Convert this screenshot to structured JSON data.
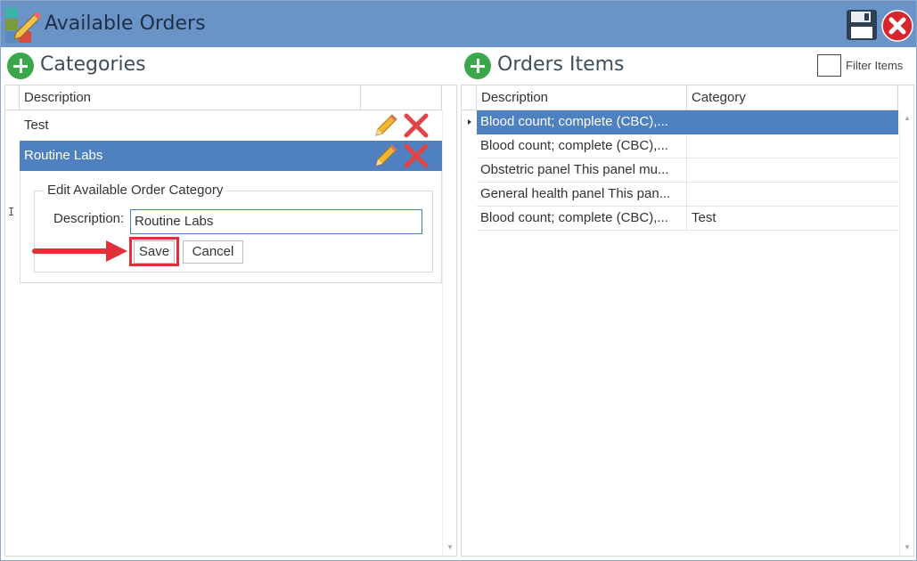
{
  "window": {
    "title": "Available Orders",
    "icons": {
      "app": "app-pencil-icon",
      "save": "floppy-disk-icon",
      "close": "close-circle-icon"
    }
  },
  "categories": {
    "title": "Categories",
    "columns": [
      "Description"
    ],
    "rows": [
      {
        "label": "Test",
        "selected": false
      },
      {
        "label": "Routine Labs",
        "selected": true
      }
    ],
    "editor": {
      "legend": "Edit Available Order Category",
      "description_label": "Description:",
      "description_value": "Routine Labs",
      "save_label": "Save",
      "cancel_label": "Cancel"
    }
  },
  "orders": {
    "title": "Orders Items",
    "filter_label": "Filter Items",
    "filter_checked": false,
    "columns": [
      "Description",
      "Category"
    ],
    "rows": [
      {
        "description": "Blood count; complete (CBC),...",
        "category": "",
        "selected": true
      },
      {
        "description": "Blood count; complete (CBC),...",
        "category": "",
        "selected": false
      },
      {
        "description": "Obstetric panel This panel mu...",
        "category": "",
        "selected": false
      },
      {
        "description": "General health panel This pan...",
        "category": "",
        "selected": false
      },
      {
        "description": "Blood count; complete (CBC),...",
        "category": "Test",
        "selected": false
      }
    ]
  },
  "colors": {
    "titlebar": "#6a93c8",
    "selection": "#4f80bf",
    "add_button": "#3aa84a",
    "highlight": "#e0303a"
  }
}
